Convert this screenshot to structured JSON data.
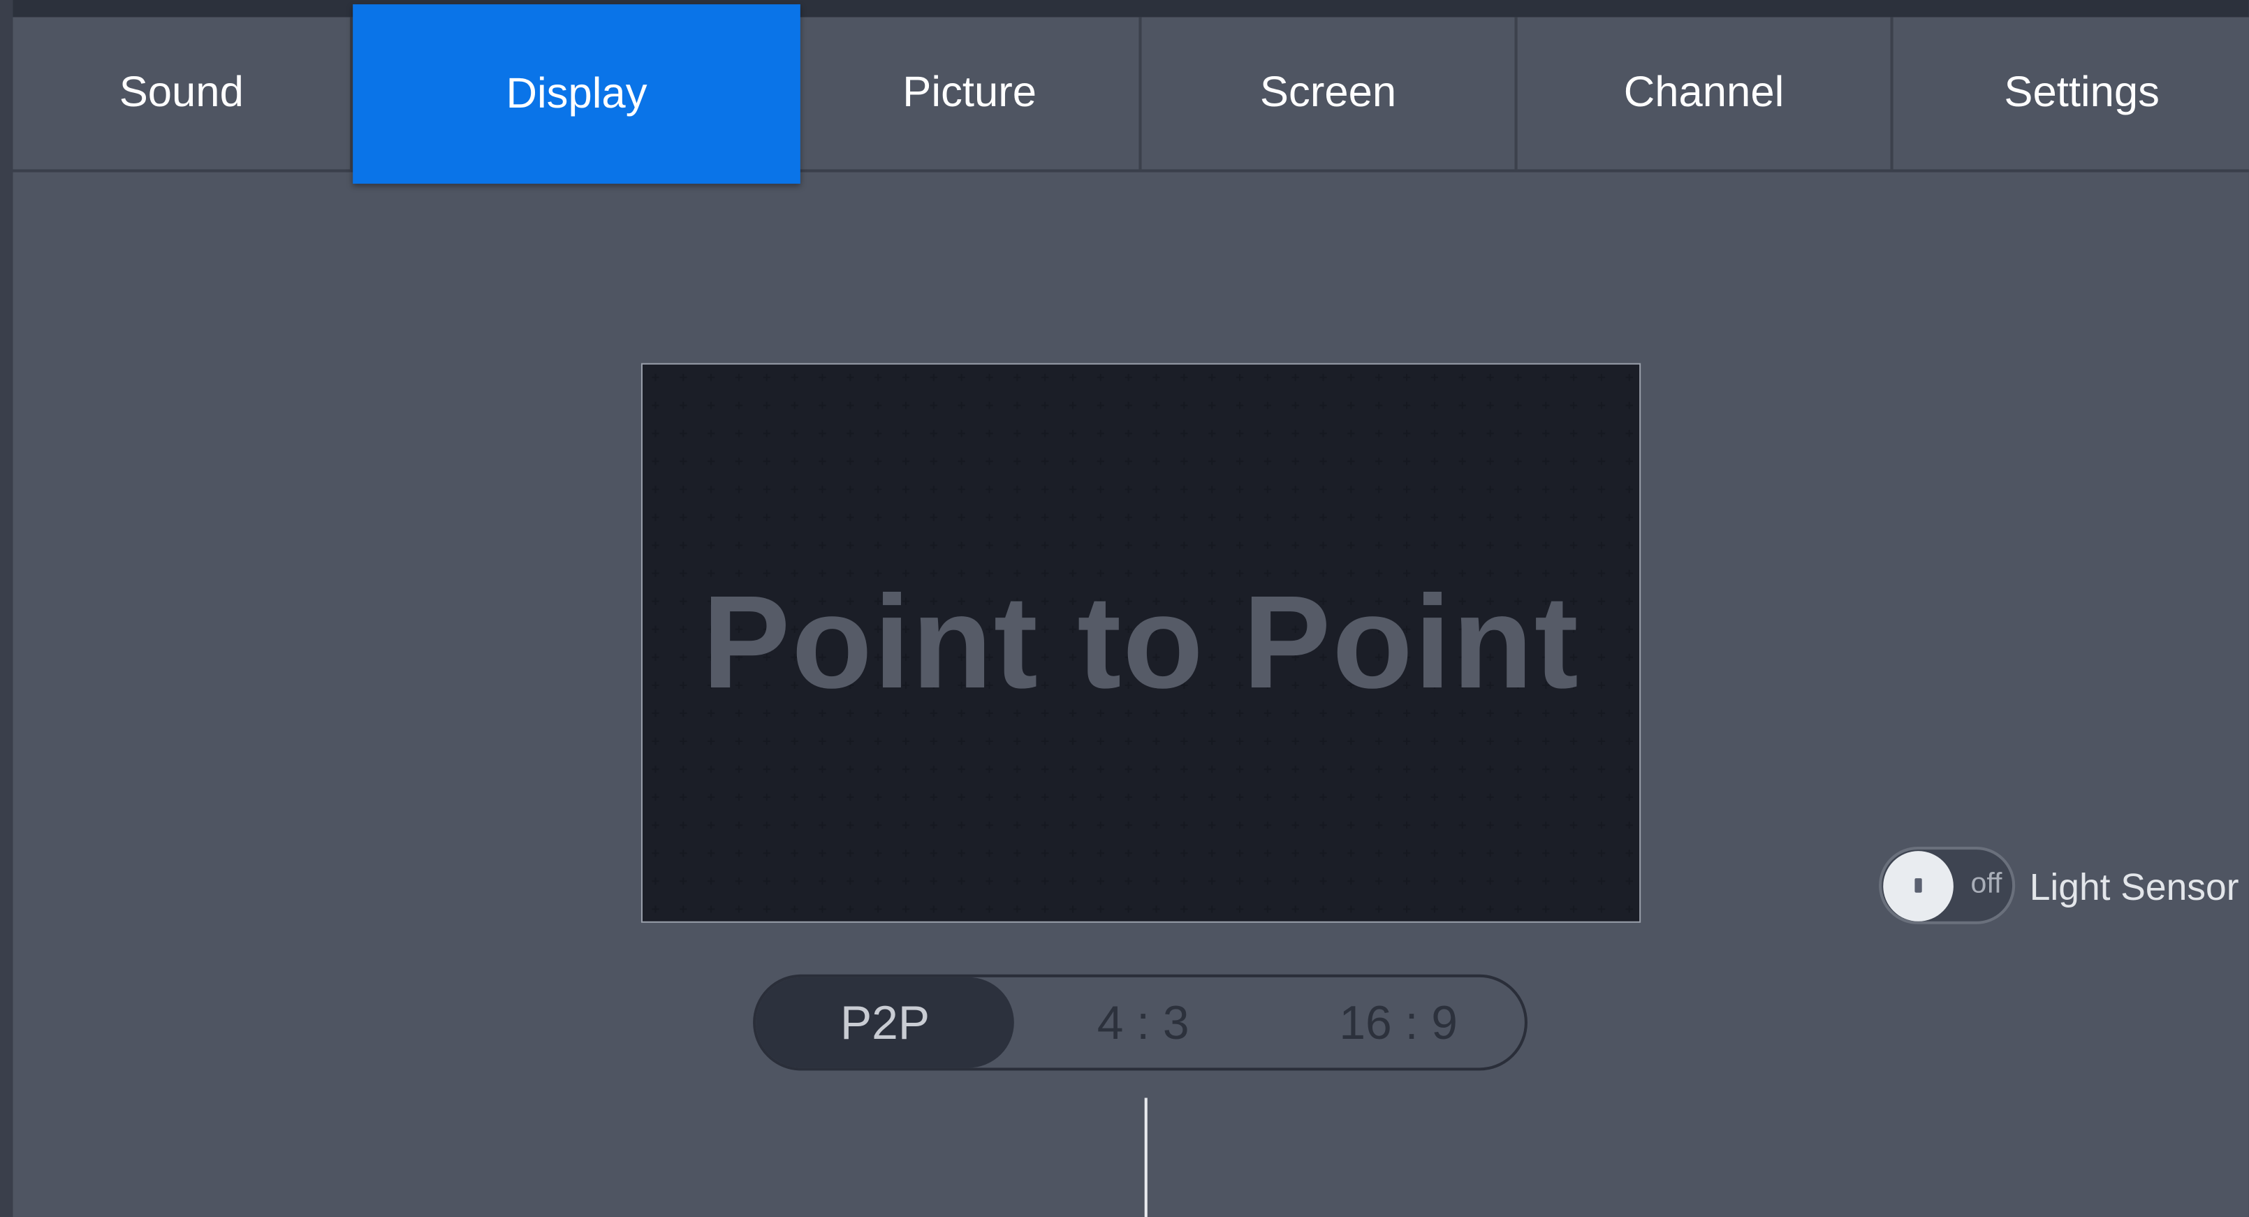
{
  "tabs": [
    {
      "label": "Sound"
    },
    {
      "label": "Display"
    },
    {
      "label": "Picture"
    },
    {
      "label": "Screen"
    },
    {
      "label": "Channel"
    },
    {
      "label": "Settings"
    }
  ],
  "active_tab": "Display",
  "preview": {
    "label": "Point to Point"
  },
  "aspect_options": [
    "P2P",
    "4 : 3",
    "16 : 9"
  ],
  "aspect_selected": "P2P",
  "light_sensor": {
    "label": "Light Sensor",
    "state_text": "off"
  },
  "colors": {
    "background": "#4f5562",
    "accent": "#0a74e8",
    "preview_bg": "#2d313d",
    "text": "#ffffff"
  }
}
